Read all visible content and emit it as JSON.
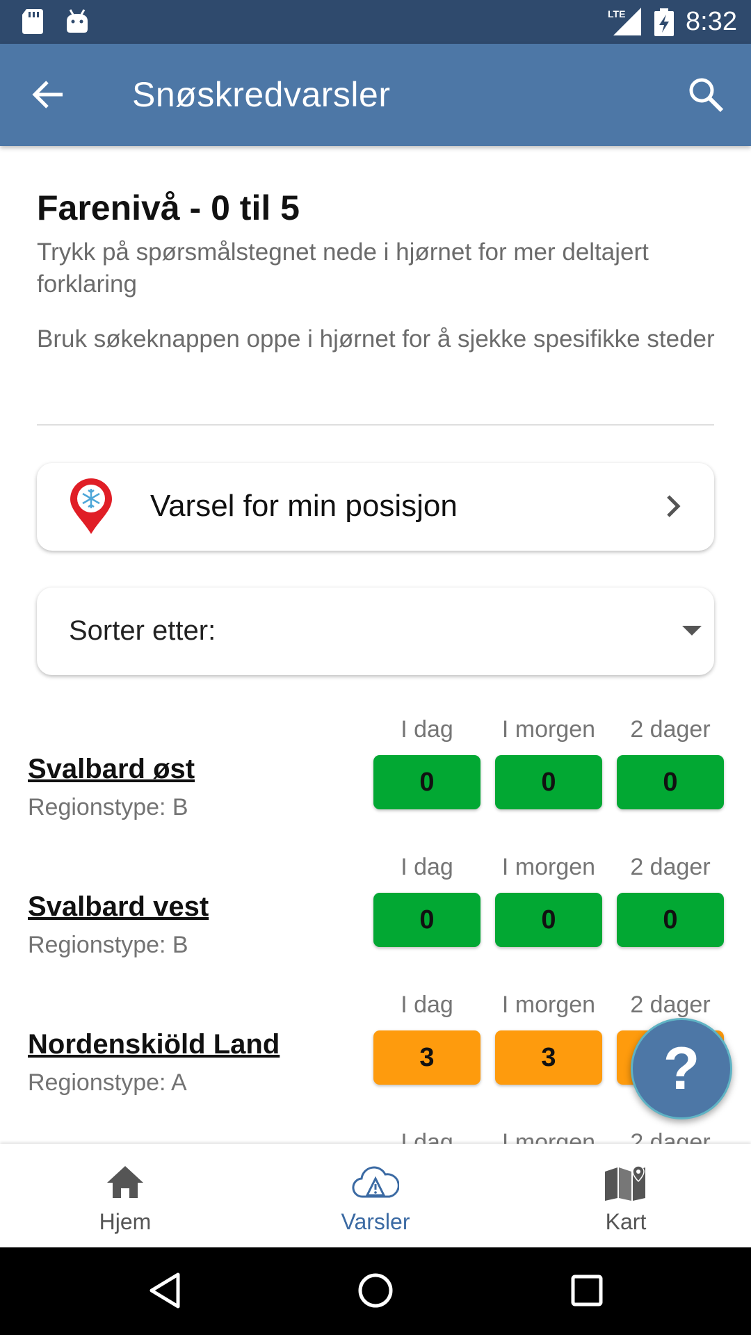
{
  "status_bar": {
    "time": "8:32",
    "network": "LTE"
  },
  "app_bar": {
    "title": "Snøskredvarsler"
  },
  "intro": {
    "title": "Farenivå - 0 til 5",
    "text1": "Trykk på spørsmålstegnet nede i hjørnet for mer deltajert forklaring",
    "text2": "Bruk søkeknappen oppe i hjørnet for å sjekke spesifikke steder"
  },
  "position_card": {
    "label": "Varsel for min posisjon"
  },
  "sort": {
    "label": "Sorter etter:"
  },
  "columns": [
    "I dag",
    "I morgen",
    "2 dager"
  ],
  "regions": [
    {
      "name": "Svalbard øst",
      "type": "Regionstype: B",
      "levels": [
        "0",
        "0",
        "0"
      ]
    },
    {
      "name": "Svalbard vest",
      "type": "Regionstype: B",
      "levels": [
        "0",
        "0",
        "0"
      ]
    },
    {
      "name": "Nordenskiöld Land",
      "type": "Regionstype: A",
      "levels": [
        "3",
        "3",
        "3"
      ]
    }
  ],
  "level_colors": {
    "0": "#02a833",
    "3": "#fe9b0d"
  },
  "fab": {
    "glyph": "?"
  },
  "bottom_nav": {
    "items": [
      {
        "label": "Hjem",
        "icon": "home-icon"
      },
      {
        "label": "Varsler",
        "icon": "cloud-warning-icon",
        "active": true
      },
      {
        "label": "Kart",
        "icon": "map-icon"
      }
    ]
  },
  "colors": {
    "app_bar": "#4d77a6",
    "status_bar": "#2f4a6d",
    "active_nav": "#3b6aa3"
  }
}
